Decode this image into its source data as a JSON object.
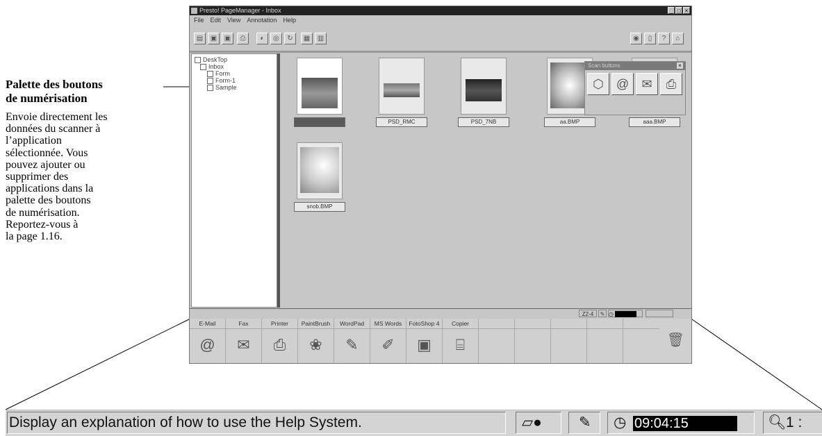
{
  "annotation": {
    "title_line1": "Palette des boutons",
    "title_line2": "de numérisation",
    "body_lines": [
      "Envoie directement les",
      "données du scanner à",
      "l’application",
      "sélectionnée. Vous",
      "pouvez ajouter ou",
      "supprimer des",
      "applications dans la",
      "palette des boutons",
      "de numérisation.",
      "Reportez-vous à",
      "la page 1.16."
    ]
  },
  "window": {
    "title": "Presto! PageManager - Inbox",
    "menu": [
      "File",
      "Edit",
      "View",
      "Annotation",
      "Help"
    ],
    "tree": [
      "DeskTop",
      "Inbox",
      "Form",
      "Form-1",
      "Sample"
    ],
    "thumbnails": [
      {
        "caption": "BLACK&WHT",
        "selected": true
      },
      {
        "caption": "PSD_RMC",
        "selected": false
      },
      {
        "caption": "PSD_7NB",
        "selected": false
      },
      {
        "caption": "aa.BMP",
        "selected": false
      },
      {
        "caption": "aaa.BMP",
        "selected": false
      },
      {
        "caption": "snob.BMP",
        "selected": false
      }
    ],
    "palette_title": "Scan buttons",
    "status": {
      "zoom": "Z2-4",
      "clock": "09:04:15"
    },
    "apps": [
      "E-Mail",
      "Fax",
      "Printer",
      "PaintBrush",
      "WordPad",
      "MS Words",
      "FotoShop 4",
      "Copier"
    ]
  },
  "status_zoom": {
    "message": "Display an explanation of how to use the Help System.",
    "time": "09:04:15",
    "zoom": "1 :"
  }
}
